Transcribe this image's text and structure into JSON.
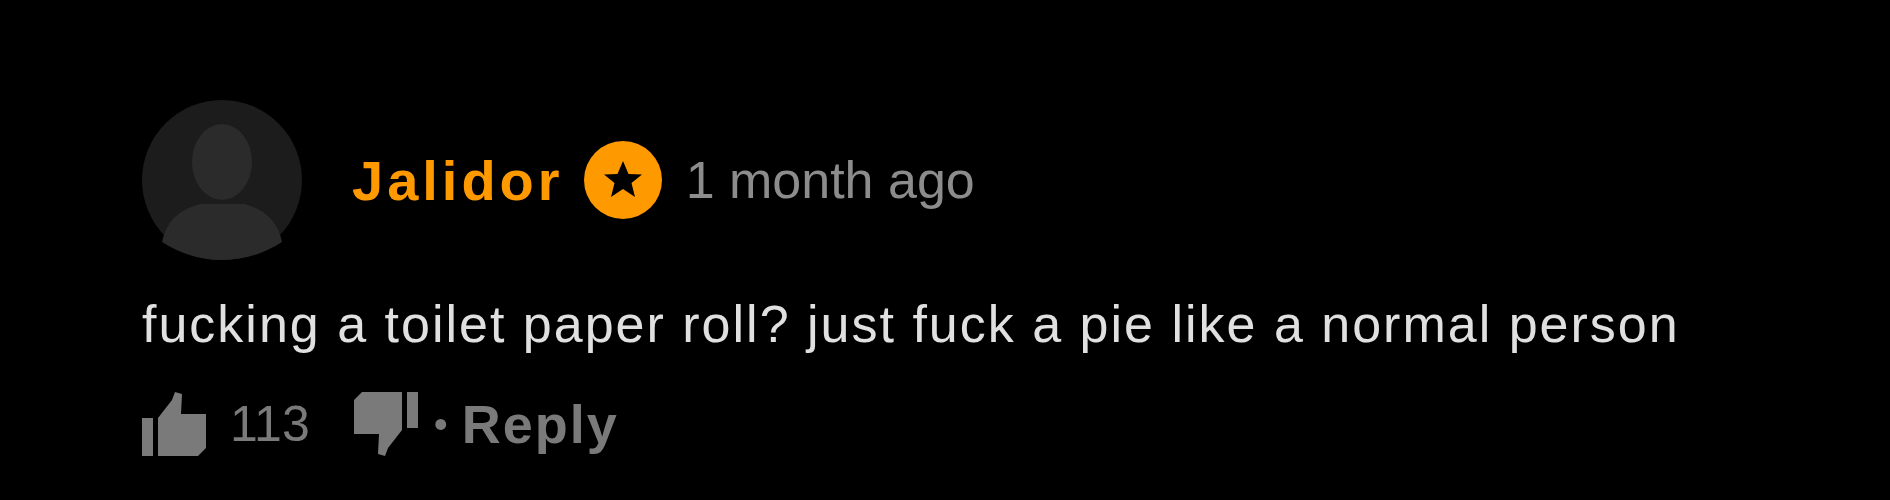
{
  "comment": {
    "author": "Jalidor",
    "verified_badge": true,
    "time": "1 month ago",
    "text": "fucking a toilet paper roll? just fuck a pie like a normal person",
    "likes": "113",
    "separator": "•",
    "reply": "Reply"
  }
}
